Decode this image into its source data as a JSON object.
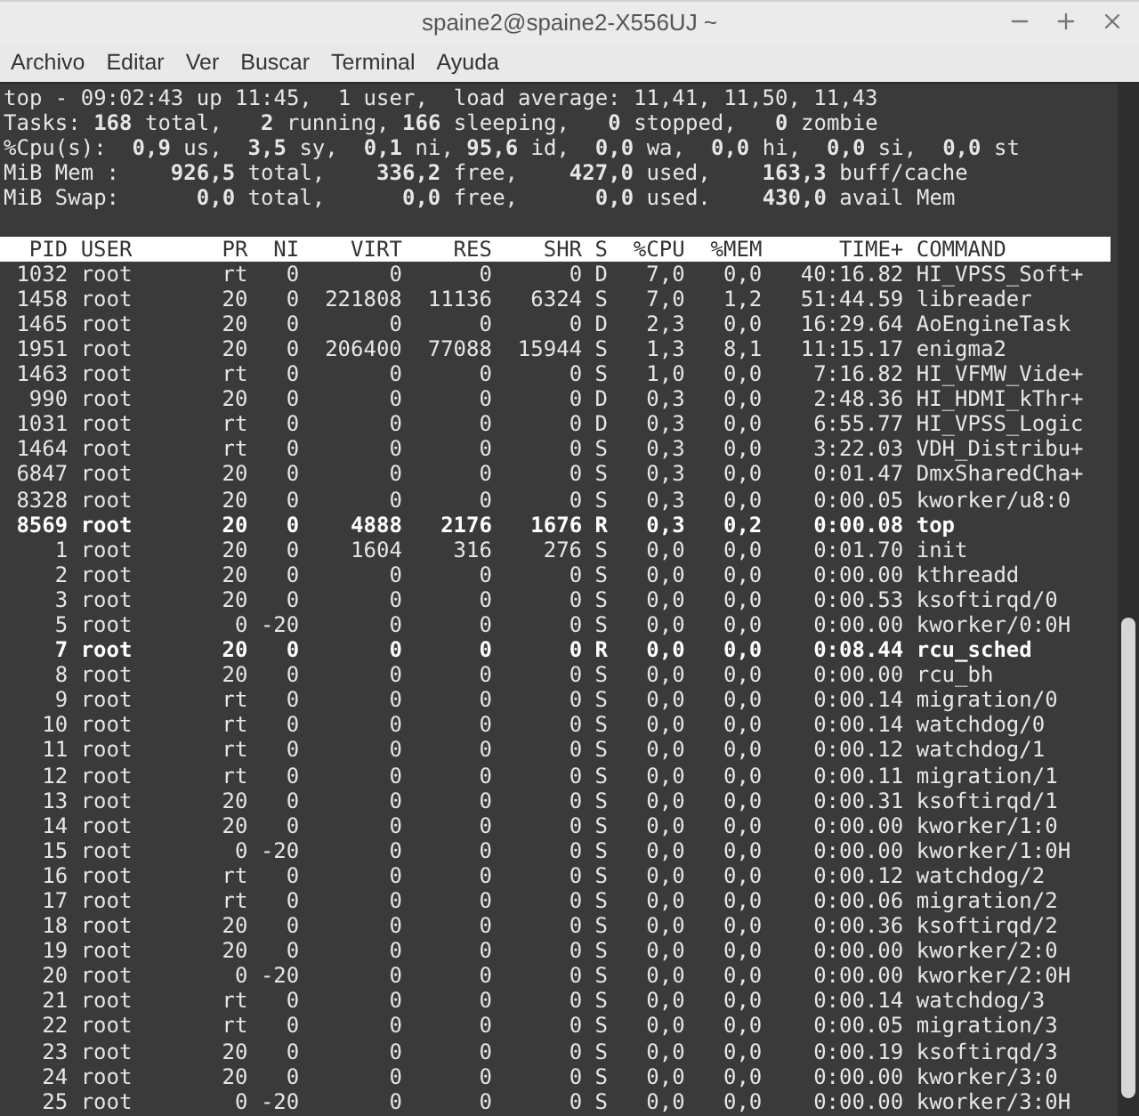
{
  "window": {
    "title": "spaine2@spaine2-X556UJ ~"
  },
  "menu": [
    "Archivo",
    "Editar",
    "Ver",
    "Buscar",
    "Terminal",
    "Ayuda"
  ],
  "summary": [
    "top - 09:02:43 up 11:45,  1 user,  load average: 11,41, 11,50, 11,43",
    "Tasks: **168** total,   **2** running, **166** sleeping,   **0** stopped,   **0** zombie",
    "%Cpu(s):  **0,9** us,  **3,5** sy,  **0,1** ni, **95,6** id,  **0,0** wa,  **0,0** hi,  **0,0** si,  **0,0** st",
    "MiB Mem :    **926,5** total,    **336,2** free,    **427,0** used,    **163,3** buff/cache",
    "MiB Swap:      **0,0** total,      **0,0** free,      **0,0** used.    **430,0** avail Mem"
  ],
  "columns": [
    "PID",
    "USER",
    "PR",
    "NI",
    "VIRT",
    "RES",
    "SHR",
    "S",
    "%CPU",
    "%MEM",
    "TIME+",
    "COMMAND"
  ],
  "rows": [
    {
      "highlighted": false,
      "cells": [
        "1032",
        "root",
        "rt",
        "0",
        "0",
        "0",
        "0",
        "D",
        "7,0",
        "0,0",
        "40:16.82",
        "HI_VPSS_Soft+"
      ]
    },
    {
      "highlighted": false,
      "cells": [
        "1458",
        "root",
        "20",
        "0",
        "221808",
        "11136",
        "6324",
        "S",
        "7,0",
        "1,2",
        "51:44.59",
        "libreader"
      ]
    },
    {
      "highlighted": false,
      "cells": [
        "1465",
        "root",
        "20",
        "0",
        "0",
        "0",
        "0",
        "D",
        "2,3",
        "0,0",
        "16:29.64",
        "AoEngineTask"
      ]
    },
    {
      "highlighted": false,
      "cells": [
        "1951",
        "root",
        "20",
        "0",
        "206400",
        "77088",
        "15944",
        "S",
        "1,3",
        "8,1",
        "11:15.17",
        "enigma2"
      ]
    },
    {
      "highlighted": false,
      "cells": [
        "1463",
        "root",
        "rt",
        "0",
        "0",
        "0",
        "0",
        "S",
        "1,0",
        "0,0",
        "7:16.82",
        "HI_VFMW_Vide+"
      ]
    },
    {
      "highlighted": false,
      "cells": [
        "990",
        "root",
        "20",
        "0",
        "0",
        "0",
        "0",
        "D",
        "0,3",
        "0,0",
        "2:48.36",
        "HI_HDMI_kThr+"
      ]
    },
    {
      "highlighted": false,
      "cells": [
        "1031",
        "root",
        "rt",
        "0",
        "0",
        "0",
        "0",
        "D",
        "0,3",
        "0,0",
        "6:55.77",
        "HI_VPSS_Logic"
      ]
    },
    {
      "highlighted": false,
      "cells": [
        "1464",
        "root",
        "rt",
        "0",
        "0",
        "0",
        "0",
        "S",
        "0,3",
        "0,0",
        "3:22.03",
        "VDH_Distribu+"
      ]
    },
    {
      "highlighted": false,
      "cells": [
        "6847",
        "root",
        "20",
        "0",
        "0",
        "0",
        "0",
        "S",
        "0,3",
        "0,0",
        "0:01.47",
        "DmxSharedCha+"
      ]
    },
    {
      "highlighted": false,
      "cells": [
        "8328",
        "root",
        "20",
        "0",
        "0",
        "0",
        "0",
        "S",
        "0,3",
        "0,0",
        "0:00.05",
        "kworker/u8:0"
      ]
    },
    {
      "highlighted": true,
      "cells": [
        "8569",
        "root",
        "20",
        "0",
        "4888",
        "2176",
        "1676",
        "R",
        "0,3",
        "0,2",
        "0:00.08",
        "top"
      ]
    },
    {
      "highlighted": false,
      "cells": [
        "1",
        "root",
        "20",
        "0",
        "1604",
        "316",
        "276",
        "S",
        "0,0",
        "0,0",
        "0:01.70",
        "init"
      ]
    },
    {
      "highlighted": false,
      "cells": [
        "2",
        "root",
        "20",
        "0",
        "0",
        "0",
        "0",
        "S",
        "0,0",
        "0,0",
        "0:00.00",
        "kthreadd"
      ]
    },
    {
      "highlighted": false,
      "cells": [
        "3",
        "root",
        "20",
        "0",
        "0",
        "0",
        "0",
        "S",
        "0,0",
        "0,0",
        "0:00.53",
        "ksoftirqd/0"
      ]
    },
    {
      "highlighted": false,
      "cells": [
        "5",
        "root",
        "0",
        "-20",
        "0",
        "0",
        "0",
        "S",
        "0,0",
        "0,0",
        "0:00.00",
        "kworker/0:0H"
      ]
    },
    {
      "highlighted": true,
      "cells": [
        "7",
        "root",
        "20",
        "0",
        "0",
        "0",
        "0",
        "R",
        "0,0",
        "0,0",
        "0:08.44",
        "rcu_sched"
      ]
    },
    {
      "highlighted": false,
      "cells": [
        "8",
        "root",
        "20",
        "0",
        "0",
        "0",
        "0",
        "S",
        "0,0",
        "0,0",
        "0:00.00",
        "rcu_bh"
      ]
    },
    {
      "highlighted": false,
      "cells": [
        "9",
        "root",
        "rt",
        "0",
        "0",
        "0",
        "0",
        "S",
        "0,0",
        "0,0",
        "0:00.14",
        "migration/0"
      ]
    },
    {
      "highlighted": false,
      "cells": [
        "10",
        "root",
        "rt",
        "0",
        "0",
        "0",
        "0",
        "S",
        "0,0",
        "0,0",
        "0:00.14",
        "watchdog/0"
      ]
    },
    {
      "highlighted": false,
      "cells": [
        "11",
        "root",
        "rt",
        "0",
        "0",
        "0",
        "0",
        "S",
        "0,0",
        "0,0",
        "0:00.12",
        "watchdog/1"
      ]
    },
    {
      "highlighted": false,
      "cells": [
        "12",
        "root",
        "rt",
        "0",
        "0",
        "0",
        "0",
        "S",
        "0,0",
        "0,0",
        "0:00.11",
        "migration/1"
      ]
    },
    {
      "highlighted": false,
      "cells": [
        "13",
        "root",
        "20",
        "0",
        "0",
        "0",
        "0",
        "S",
        "0,0",
        "0,0",
        "0:00.31",
        "ksoftirqd/1"
      ]
    },
    {
      "highlighted": false,
      "cells": [
        "14",
        "root",
        "20",
        "0",
        "0",
        "0",
        "0",
        "S",
        "0,0",
        "0,0",
        "0:00.00",
        "kworker/1:0"
      ]
    },
    {
      "highlighted": false,
      "cells": [
        "15",
        "root",
        "0",
        "-20",
        "0",
        "0",
        "0",
        "S",
        "0,0",
        "0,0",
        "0:00.00",
        "kworker/1:0H"
      ]
    },
    {
      "highlighted": false,
      "cells": [
        "16",
        "root",
        "rt",
        "0",
        "0",
        "0",
        "0",
        "S",
        "0,0",
        "0,0",
        "0:00.12",
        "watchdog/2"
      ]
    },
    {
      "highlighted": false,
      "cells": [
        "17",
        "root",
        "rt",
        "0",
        "0",
        "0",
        "0",
        "S",
        "0,0",
        "0,0",
        "0:00.06",
        "migration/2"
      ]
    },
    {
      "highlighted": false,
      "cells": [
        "18",
        "root",
        "20",
        "0",
        "0",
        "0",
        "0",
        "S",
        "0,0",
        "0,0",
        "0:00.36",
        "ksoftirqd/2"
      ]
    },
    {
      "highlighted": false,
      "cells": [
        "19",
        "root",
        "20",
        "0",
        "0",
        "0",
        "0",
        "S",
        "0,0",
        "0,0",
        "0:00.00",
        "kworker/2:0"
      ]
    },
    {
      "highlighted": false,
      "cells": [
        "20",
        "root",
        "0",
        "-20",
        "0",
        "0",
        "0",
        "S",
        "0,0",
        "0,0",
        "0:00.00",
        "kworker/2:0H"
      ]
    },
    {
      "highlighted": false,
      "cells": [
        "21",
        "root",
        "rt",
        "0",
        "0",
        "0",
        "0",
        "S",
        "0,0",
        "0,0",
        "0:00.14",
        "watchdog/3"
      ]
    },
    {
      "highlighted": false,
      "cells": [
        "22",
        "root",
        "rt",
        "0",
        "0",
        "0",
        "0",
        "S",
        "0,0",
        "0,0",
        "0:00.05",
        "migration/3"
      ]
    },
    {
      "highlighted": false,
      "cells": [
        "23",
        "root",
        "20",
        "0",
        "0",
        "0",
        "0",
        "S",
        "0,0",
        "0,0",
        "0:00.19",
        "ksoftirqd/3"
      ]
    },
    {
      "highlighted": false,
      "cells": [
        "24",
        "root",
        "20",
        "0",
        "0",
        "0",
        "0",
        "S",
        "0,0",
        "0,0",
        "0:00.00",
        "kworker/3:0"
      ]
    },
    {
      "highlighted": false,
      "cells": [
        "25",
        "root",
        "0",
        "-20",
        "0",
        "0",
        "0",
        "S",
        "0,0",
        "0,0",
        "0:00.00",
        "kworker/3:0H"
      ]
    }
  ]
}
